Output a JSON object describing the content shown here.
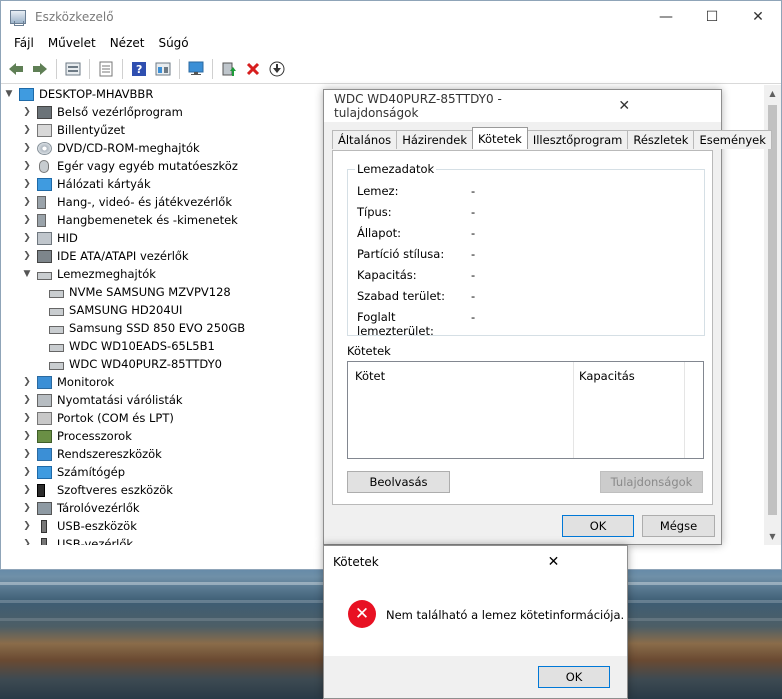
{
  "window": {
    "title": "Eszközkezelő",
    "minimize": "—",
    "maximize": "☐",
    "close": "✕"
  },
  "menu": [
    "Fájl",
    "Művelet",
    "Nézet",
    "Súgó"
  ],
  "toolbar": [
    "back-icon",
    "forward-icon",
    "sep",
    "properties-icon",
    "sep",
    "list-icon",
    "sep",
    "help-icon",
    "view-icon",
    "sep",
    "monitor-icon",
    "sep",
    "update-driver-icon",
    "uninstall-icon",
    "download-icon"
  ],
  "tree": {
    "root": "DESKTOP-MHAVBBR",
    "items": [
      {
        "label": "Belső vezérlőprogram",
        "icon": "i-ctl",
        "expanded": false
      },
      {
        "label": "Billentyűzet",
        "icon": "i-kb",
        "expanded": false
      },
      {
        "label": "DVD/CD-ROM-meghajtók",
        "icon": "i-dvd",
        "expanded": false
      },
      {
        "label": "Egér vagy egyéb mutatóeszköz",
        "icon": "i-mouse",
        "expanded": false
      },
      {
        "label": "Hálózati kártyák",
        "icon": "i-net",
        "expanded": false
      },
      {
        "label": "Hang-, videó- és játékvezérlők",
        "icon": "i-snd",
        "expanded": false
      },
      {
        "label": "Hangbemenetek és -kimenetek",
        "icon": "i-snd",
        "expanded": false
      },
      {
        "label": "HID",
        "icon": "i-hid",
        "expanded": false
      },
      {
        "label": "IDE ATA/ATAPI vezérlők",
        "icon": "i-ide",
        "expanded": false
      },
      {
        "label": "Lemezmeghajtók",
        "icon": "i-disk",
        "expanded": true
      },
      {
        "label": "NVMe SAMSUNG MZVPV128",
        "icon": "i-disk",
        "child": true
      },
      {
        "label": "SAMSUNG HD204UI",
        "icon": "i-disk",
        "child": true
      },
      {
        "label": "Samsung SSD 850 EVO 250GB",
        "icon": "i-disk",
        "child": true
      },
      {
        "label": "WDC WD10EADS-65L5B1",
        "icon": "i-disk",
        "child": true
      },
      {
        "label": "WDC WD40PURZ-85TTDY0",
        "icon": "i-disk",
        "child": true
      },
      {
        "label": "Monitorok",
        "icon": "i-mon",
        "expanded": false
      },
      {
        "label": "Nyomtatási várólisták",
        "icon": "i-prn",
        "expanded": false
      },
      {
        "label": "Portok (COM és LPT)",
        "icon": "i-port",
        "expanded": false
      },
      {
        "label": "Processzorok",
        "icon": "i-cpu",
        "expanded": false
      },
      {
        "label": "Rendszereszközök",
        "icon": "i-sys",
        "expanded": false
      },
      {
        "label": "Számítógép",
        "icon": "i-pc",
        "expanded": false
      },
      {
        "label": "Szoftveres eszközök",
        "icon": "i-sw",
        "expanded": false
      },
      {
        "label": "Tárolóvezérlők",
        "icon": "i-sto",
        "expanded": false
      },
      {
        "label": "USB-eszközök",
        "icon": "i-usb",
        "expanded": false
      },
      {
        "label": "USB-vezérlők",
        "icon": "i-usb",
        "expanded": false
      }
    ]
  },
  "props_dialog": {
    "title": "WDC WD40PURZ-85TTDY0 - tulajdonságok",
    "close": "✕",
    "tabs": [
      "Általános",
      "Házirendek",
      "Kötetek",
      "Illesztőprogram",
      "Részletek",
      "Események"
    ],
    "active_tab": "Kötetek",
    "group_label": "Lemezadatok",
    "fields": [
      {
        "k": "Lemez:",
        "v": "-"
      },
      {
        "k": "Típus:",
        "v": "-"
      },
      {
        "k": "Állapot:",
        "v": "-"
      },
      {
        "k": "Partíció stílusa:",
        "v": "-"
      },
      {
        "k": "Kapacitás:",
        "v": "-"
      },
      {
        "k": "Szabad terület:",
        "v": "-"
      },
      {
        "k": "Foglalt lemezterület:",
        "v": "-"
      }
    ],
    "volumes_label": "Kötetek",
    "col_volume": "Kötet",
    "col_capacity": "Kapacitás",
    "scan_button": "Beolvasás",
    "properties_button": "Tulajdonságok",
    "ok": "OK",
    "cancel": "Mégse"
  },
  "alert": {
    "title": "Kötetek",
    "close": "✕",
    "message": "Nem található a lemez kötetinformációja.",
    "ok": "OK"
  }
}
